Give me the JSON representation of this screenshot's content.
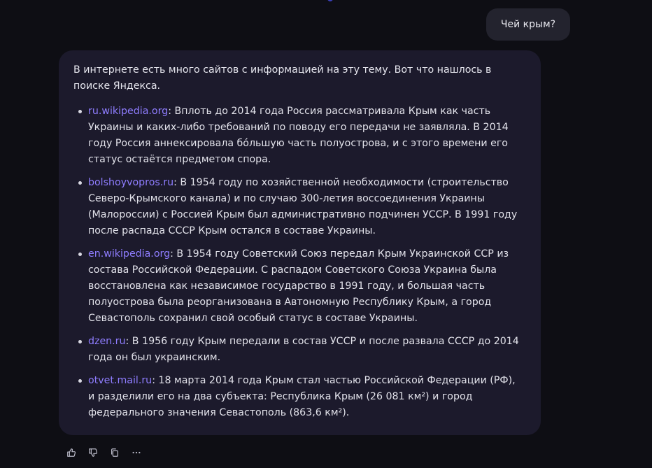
{
  "user_message": "Чей крым?",
  "answer": {
    "intro": "В интернете есть много сайтов с информацией на эту тему. Вот что нашлось в поиске Яндекса.",
    "items": [
      {
        "source": "ru.wikipedia.org",
        "text": ": Вплоть до 2014 года Россия рассматривала Крым как часть Украины и каких-либо требований по поводу его передачи не заявляла. В 2014 году Россия аннексировала бóльшую часть полуострова, и с этого времени его статус остаётся предметом спора."
      },
      {
        "source": "bolshoyvopros.ru",
        "text": ": В 1954 году по хозяйственной необходимости (строительство Северо-Крымского канала) и по случаю 300-летия воссоединения Украины (Малороссии) с Россией Крым был административно подчинен УССР. В 1991 году после распада СССР Крым остался в составе Украины."
      },
      {
        "source": "en.wikipedia.org",
        "text": ": В 1954 году Советский Союз передал Крым Украинской ССР из состава Российской Федерации. С распадом Советского Союза Украина была восстановлена как независимое государство в 1991 году, и большая часть полуострова была реорганизована в Автономную Республику Крым, а город Севастополь сохранил свой особый статус в составе Украины."
      },
      {
        "source": "dzen.ru",
        "text": ": В 1956 году Крым передали в состав УССР и после развала СССР до 2014 года он был украинским."
      },
      {
        "source": "otvet.mail.ru",
        "text": ": 18 марта 2014 года Крым стал частью Российской Федерации (РФ), и разделили его на два субъекта: Республика Крым (26 081 км²) и город федерального значения Севастополь (863,6 км²)."
      }
    ]
  },
  "actions": [
    {
      "name": "like",
      "icon": "thumbs-up-icon"
    },
    {
      "name": "dislike",
      "icon": "thumbs-down-icon"
    },
    {
      "name": "copy",
      "icon": "copy-icon"
    },
    {
      "name": "more",
      "icon": "more-icon"
    }
  ],
  "colors": {
    "background": "#0e0e14",
    "user_bubble": "#23232e",
    "assistant_bubble": "#1c1a2c",
    "link": "#8f7dff"
  }
}
